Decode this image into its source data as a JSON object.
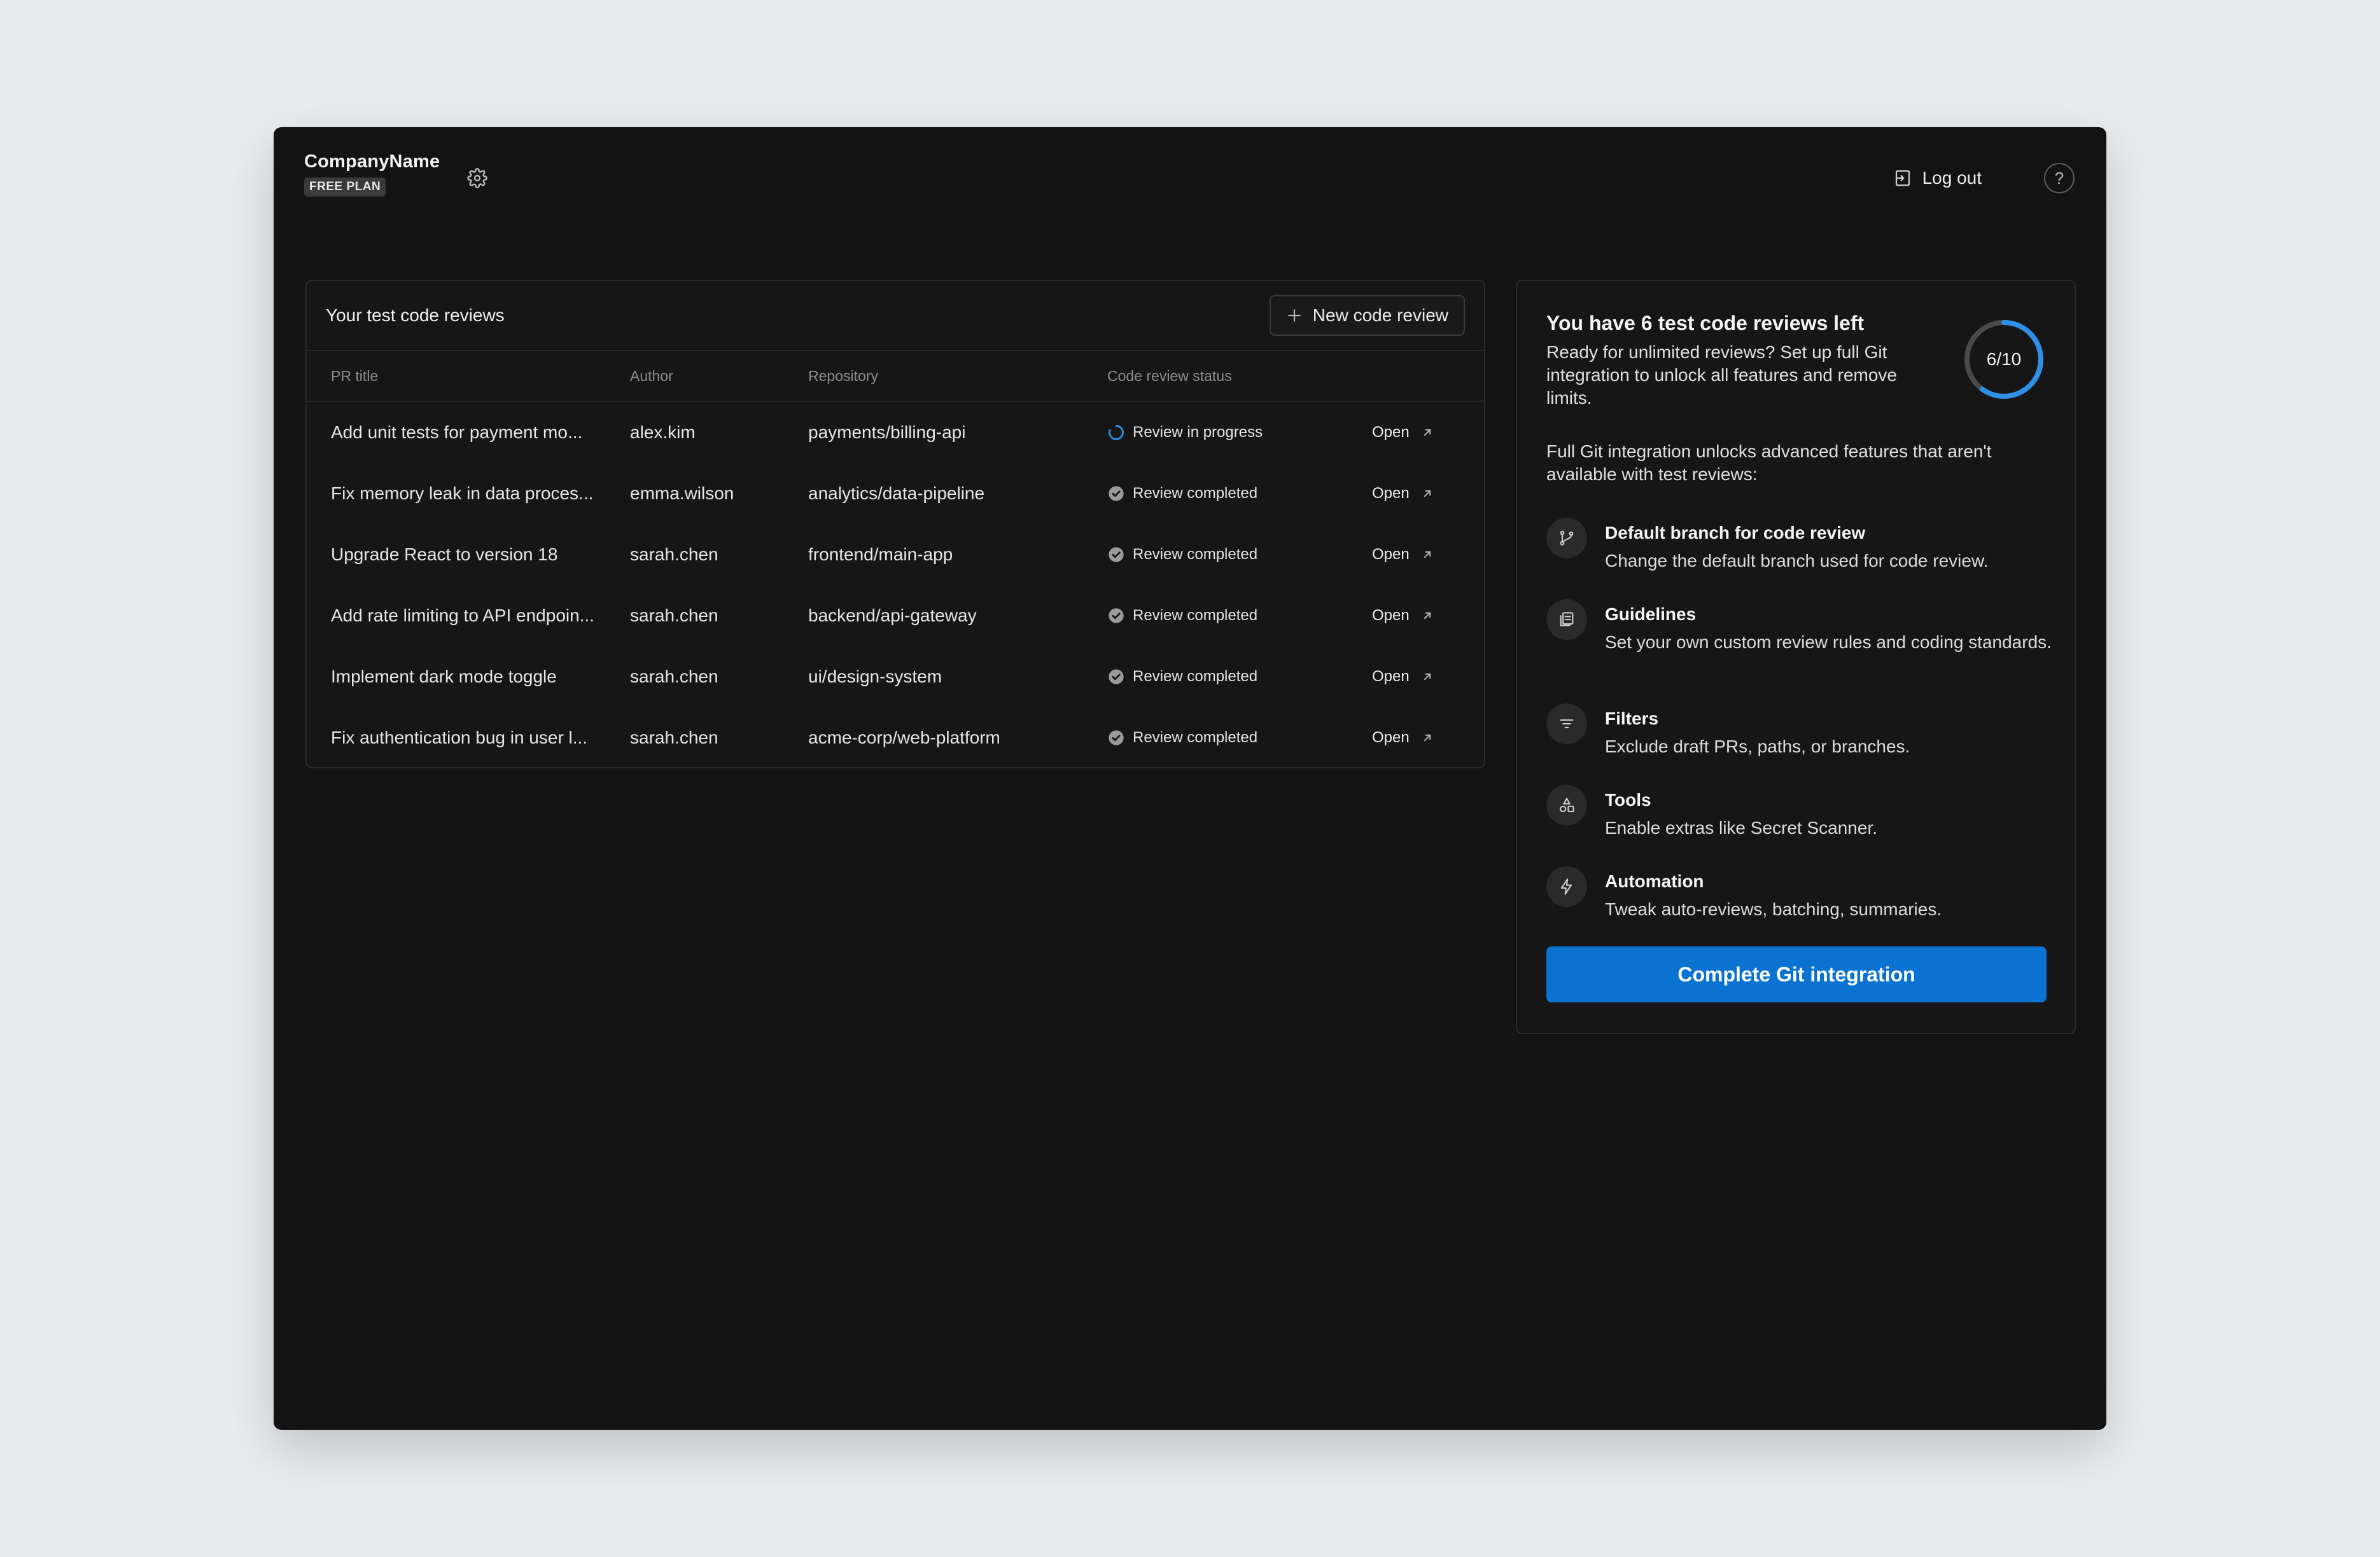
{
  "header": {
    "company_name": "CompanyName",
    "plan_badge": "FREE PLAN",
    "logout_label": "Log out",
    "help_label": "?"
  },
  "reviews": {
    "title": "Your test code reviews",
    "new_button_label": "New code review",
    "columns": [
      "PR title",
      "Author",
      "Repository",
      "Code review status",
      ""
    ],
    "rows": [
      {
        "title": "Add unit tests for payment mo...",
        "author": "alex.kim",
        "repo": "payments/billing-api",
        "status": "Review in progress",
        "status_type": "progress",
        "action": "Open"
      },
      {
        "title": "Fix memory leak in data proces...",
        "author": "emma.wilson",
        "repo": "analytics/data-pipeline",
        "status": "Review completed",
        "status_type": "completed",
        "action": "Open"
      },
      {
        "title": "Upgrade React to version 18",
        "author": "sarah.chen",
        "repo": "frontend/main-app",
        "status": "Review completed",
        "status_type": "completed",
        "action": "Open"
      },
      {
        "title": "Add rate limiting to API endpoin...",
        "author": "sarah.chen",
        "repo": "backend/api-gateway",
        "status": "Review completed",
        "status_type": "completed",
        "action": "Open"
      },
      {
        "title": "Implement dark mode toggle",
        "author": "sarah.chen",
        "repo": "ui/design-system",
        "status": "Review completed",
        "status_type": "completed",
        "action": "Open"
      },
      {
        "title": "Fix authentication bug in user l...",
        "author": "sarah.chen",
        "repo": "acme-corp/web-platform",
        "status": "Review completed",
        "status_type": "completed",
        "action": "Open"
      }
    ]
  },
  "info": {
    "title": "You have 6 test code reviews left",
    "subtitle": "Ready for unlimited reviews? Set up full Git integration to unlock all features and remove limits.",
    "usage_label": "6/10",
    "usage_fraction": 0.6,
    "intro": "Full Git integration unlocks advanced features that aren't available with test reviews:",
    "features": [
      {
        "icon": "git-branch-icon",
        "title": "Default branch for code review",
        "desc": "Change the default branch used for code review."
      },
      {
        "icon": "guidelines-icon",
        "title": "Guidelines",
        "desc": "Set your own custom review rules and coding standards."
      },
      {
        "icon": "filter-icon",
        "title": "Filters",
        "desc": "Exclude draft PRs, paths, or branches."
      },
      {
        "icon": "tools-icon",
        "title": "Tools",
        "desc": "Enable extras like Secret Scanner."
      },
      {
        "icon": "lightning-icon",
        "title": "Automation",
        "desc": "Tweak auto-reviews, batching, summaries."
      }
    ],
    "cta_label": "Complete Git integration"
  },
  "colors": {
    "accent": "#0a72d1",
    "ring_progress": "#2f8fe6",
    "ring_track": "#4a4a4a",
    "window_bg": "#131313",
    "page_bg": "#e9ecef"
  }
}
